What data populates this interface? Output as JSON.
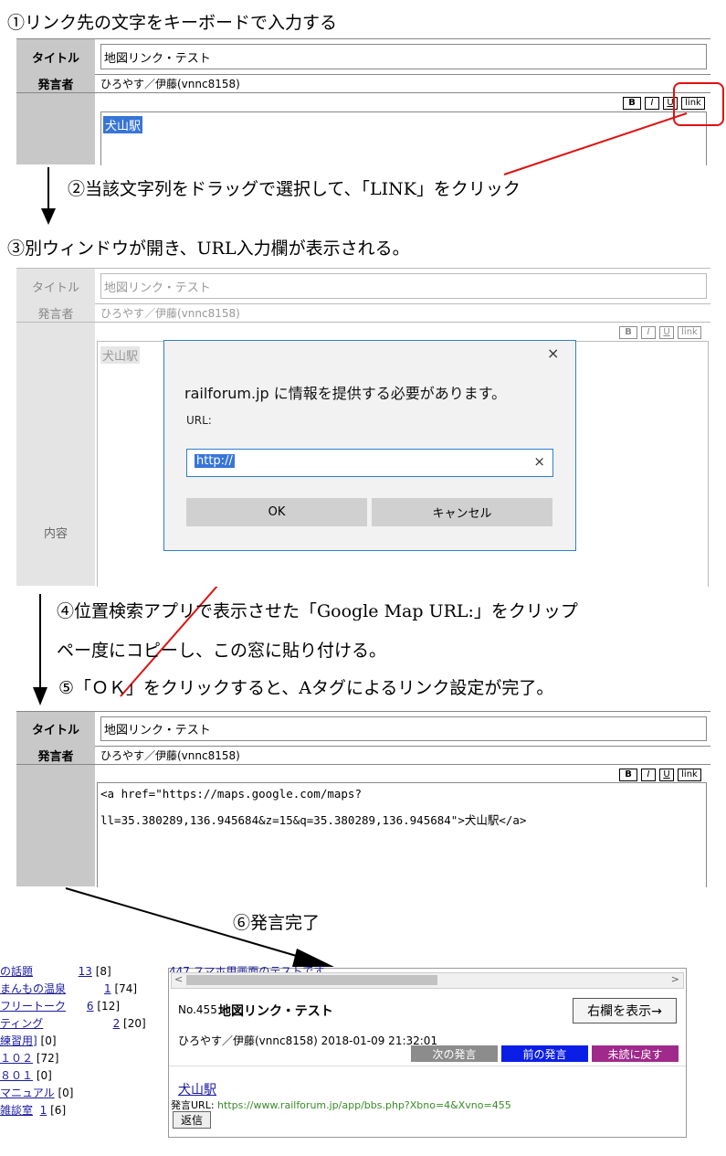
{
  "steps": {
    "s1": "①リンク先の文字をキーボードで入力する",
    "s2": "②当該文字列をドラッグで選択して、「LINK」をクリック",
    "s3": "③別ウィンドウが開き、URL入力欄が表示される。",
    "s4a": "④位置検索アプリで表示させた「Google Map URL:」をクリップ",
    "s4b": "ペー度にコピーし、この窓に貼り付ける。",
    "s5": "⑤「ＯＫ」をクリックすると、Aタグによるリンク設定が完了。",
    "s6": "⑥発言完了"
  },
  "form": {
    "title_label": "タイトル",
    "speaker_label": "発言者",
    "content_label": "内容",
    "title_value": "地図リンク・テスト",
    "speaker_value": "ひろやす／伊藤(vnnc8158)",
    "body_text": "犬山駅",
    "tool_bold": "B",
    "tool_italic": "I",
    "tool_underline": "U",
    "tool_link": "link",
    "html_line1": "<a href=\"https://maps.google.com/maps?",
    "html_line2": "ll=35.380289,136.945684&z=15&q=35.380289,136.945684\">犬山駅</a>"
  },
  "dialog": {
    "message": "railforum.jp に情報を提供する必要があります。",
    "url_label": "URL:",
    "url_value": "http://",
    "close": "×",
    "clear": "×",
    "ok": "OK",
    "cancel": "キャンセル"
  },
  "result": {
    "top_link": "447 スマホ用画面のテストです",
    "post_no": "No.455",
    "post_title": "地図リンク・テスト",
    "toggle_right": "右欄を表示→",
    "author_line": "ひろやす／伊藤(vnnc8158) 2018-01-09 21:32:01",
    "next_btn": "次の発言",
    "prev_btn": "前の発言",
    "unread_btn": "未読に戻す",
    "link_text": "犬山駅",
    "url_label": "発言URL:",
    "url_value": "https://www.railforum.jp/app/bbs.php?Xbno=4&Xvno=455",
    "reply": "返信",
    "scroll_left": "<",
    "scroll_right": ">"
  },
  "tree": [
    {
      "label": "の話題",
      "count": "13",
      "bracket": "[8]"
    },
    {
      "label": "まんもの温泉",
      "count": "1",
      "bracket": "[74]"
    },
    {
      "label": "フリートーク",
      "count": "6",
      "bracket": "[12]"
    },
    {
      "label": "ティング",
      "count": "2",
      "bracket": "[20]"
    },
    {
      "label": "練習用]",
      "count": "",
      "bracket": "[0]"
    },
    {
      "label": "１０２",
      "count": "",
      "bracket": "[72]"
    },
    {
      "label": "８０１",
      "count": "",
      "bracket": "[0]"
    },
    {
      "label": "マニュアル",
      "count": "",
      "bracket": "[0]"
    },
    {
      "label": "雑談室",
      "count": "1",
      "bracket": "[6]"
    }
  ],
  "colors": {
    "highlight": "#3875d7",
    "next_btn": "#8c8c8c",
    "prev_btn": "#0a1ee6",
    "unread_btn": "#a02a8c",
    "annotation_red": "#e01010"
  }
}
